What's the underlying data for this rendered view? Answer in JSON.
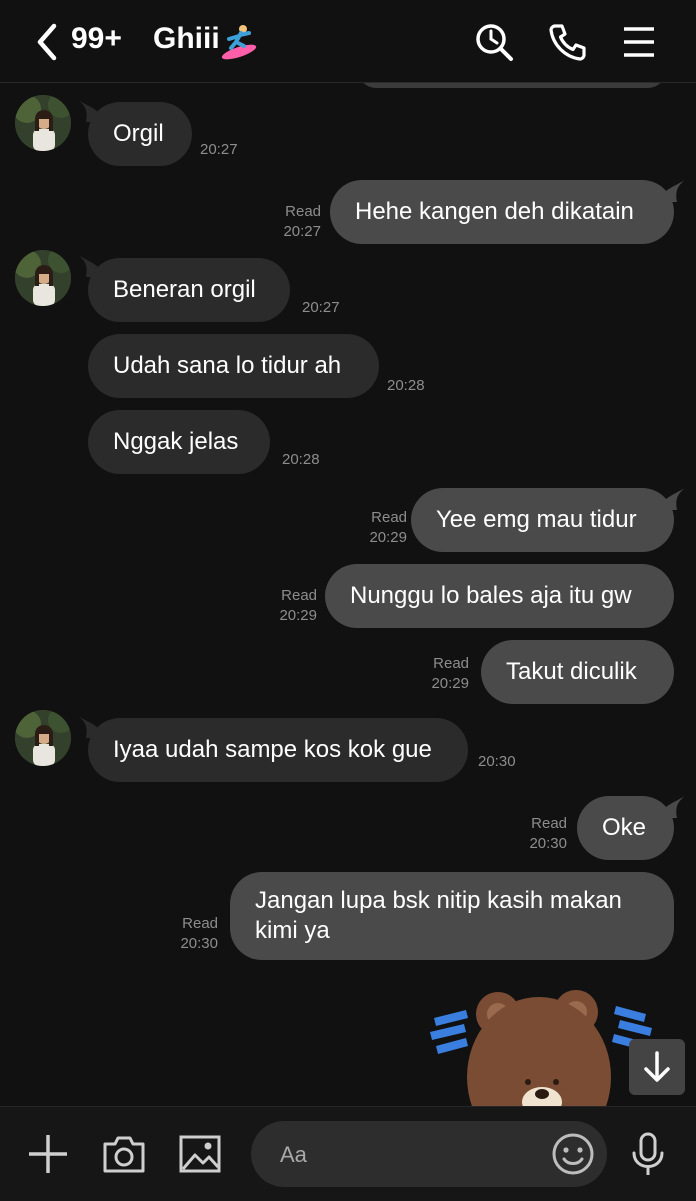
{
  "header": {
    "unread_count": "99+",
    "contact_name": "Ghiii"
  },
  "messages": [
    {
      "side": "in",
      "text": "Orgil",
      "time": "20:27"
    },
    {
      "side": "out",
      "text": "Hehe kangen deh dikatain",
      "status": "Read",
      "time": "20:27"
    },
    {
      "side": "in",
      "text": "Beneran orgil",
      "time": "20:27"
    },
    {
      "side": "in",
      "text": "Udah sana lo tidur ah",
      "time": "20:28"
    },
    {
      "side": "in",
      "text": "Nggak jelas",
      "time": "20:28"
    },
    {
      "side": "out",
      "text": "Yee emg mau tidur",
      "status": "Read",
      "time": "20:29"
    },
    {
      "side": "out",
      "text": "Nunggu lo bales aja itu gw",
      "status": "Read",
      "time": "20:29"
    },
    {
      "side": "out",
      "text": "Takut diculik",
      "status": "Read",
      "time": "20:29"
    },
    {
      "side": "in",
      "text": "Iyaa udah sampe kos kok gue",
      "time": "20:30"
    },
    {
      "side": "out",
      "text": "Oke",
      "status": "Read",
      "time": "20:30"
    },
    {
      "side": "out",
      "text": "Jangan lupa bsk nitip kasih makan kimi ya",
      "status": "Read",
      "time": "20:30"
    }
  ],
  "composer": {
    "placeholder": "Aa"
  },
  "icons": {
    "back": "chevron-left-icon",
    "search": "search-icon",
    "call": "phone-icon",
    "menu": "hamburger-menu-icon",
    "add": "plus-icon",
    "camera": "camera-icon",
    "gallery": "image-icon",
    "emoji": "smiley-icon",
    "mic": "microphone-icon",
    "scroll": "arrow-down-icon"
  },
  "colors": {
    "background": "#111111",
    "incoming_bubble": "#2b2b2b",
    "outgoing_bubble": "#4a4a4a",
    "meta_text": "#8d8d8d"
  }
}
